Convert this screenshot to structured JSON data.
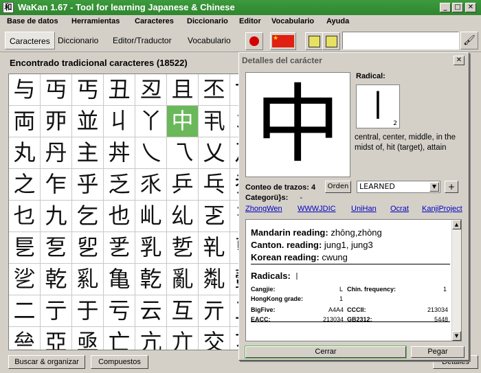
{
  "window": {
    "title": "WaKan 1.67 - Tool for learning Japanese & Chinese",
    "app_icon": "和",
    "min": "_",
    "max": "□",
    "close": "✕"
  },
  "menu": [
    "Base de datos",
    "Herramientas",
    "Caracteres",
    "Diccionario",
    "Editor",
    "Vocabulario",
    "Ayuda"
  ],
  "tabs": [
    "Caracteres",
    "Diccionario",
    "Editor/Traductor",
    "Vocabulario"
  ],
  "toolbar": {
    "cn_flag_star": "★",
    "brush": "🖌"
  },
  "grid": {
    "header": "Encontrado tradicional caracteres (18522)",
    "selected_char": "中",
    "rows": [
      [
        "与",
        "丏",
        "丐",
        "丑",
        "丒",
        "且",
        "丕",
        "世"
      ],
      [
        "両",
        "丣",
        "並",
        "丩",
        "丫",
        "中",
        "丮",
        "丯"
      ],
      [
        "丸",
        "丹",
        "主",
        "丼",
        "乀",
        "乁",
        "乂",
        "乃"
      ],
      [
        "之",
        "乍",
        "乎",
        "乏",
        "乑",
        "乒",
        "乓",
        "乔"
      ],
      [
        "乜",
        "九",
        "乞",
        "也",
        "乢",
        "乣",
        "乤",
        "乥"
      ],
      [
        "乬",
        "乭",
        "乮",
        "乯",
        "乳",
        "乴",
        "乵",
        "乶"
      ],
      [
        "乷",
        "乾",
        "乿",
        "亀",
        "亁",
        "亂",
        "亃",
        "亄"
      ],
      [
        "二",
        "亍",
        "于",
        "亏",
        "云",
        "互",
        "亓",
        "五"
      ],
      [
        "亝",
        "亞",
        "亟",
        "亡",
        "亢",
        "亣",
        "交",
        "亥"
      ]
    ]
  },
  "bottom": {
    "sort_button": "Buscar & organizar",
    "compounds_button": "Compuestos",
    "details_button": "Detalles"
  },
  "details": {
    "title": "Detalles del carácter",
    "char": "中",
    "radical_label": "Radical:",
    "radical_glyph": "丨",
    "radical_number": "2",
    "meaning": "central, center, middle, in the midst of, hit (target), attain",
    "strokes_label": "Conteo de trazos:",
    "strokes": "4",
    "order_button": "Orden",
    "learned_status": "LEARNED",
    "add_button": "+",
    "category_label": "Categorü}s:",
    "category_value": "-",
    "links": [
      "ZhongWen",
      "WWWJDIC",
      "UniHan",
      "Ocrat",
      "KanjiProject"
    ],
    "readings": [
      {
        "label": "Mandarin reading:",
        "value": "zhōng,zhòng"
      },
      {
        "label": "Canton. reading:",
        "value": "jung1, jung3"
      },
      {
        "label": "Korean reading:",
        "value": "cwung"
      }
    ],
    "radicals_title": "Radicals:",
    "radicals_glyph": "丨",
    "cangjie_label": "Cangjie:",
    "cangjie_value": "L",
    "chin_freq_label": "Chin. frequency:",
    "chin_freq_value": "1",
    "hk_grade_label": "HongKong grade:",
    "hk_grade_value": "1",
    "bigfive_label": "BigFive:",
    "bigfive_value": "A4A4",
    "cccii_label": "CCCII:",
    "cccii_value": "213034",
    "eacc_label": "EACC:",
    "eacc_value": "213034",
    "gb_label": "GB2312:",
    "gb_value": "5448",
    "close_button": "Cerrar",
    "paste_button": "Pegar"
  },
  "colors": {
    "titlebar": "#2f862f",
    "selected_cell": "#6ab85a",
    "link": "#0000c0"
  }
}
